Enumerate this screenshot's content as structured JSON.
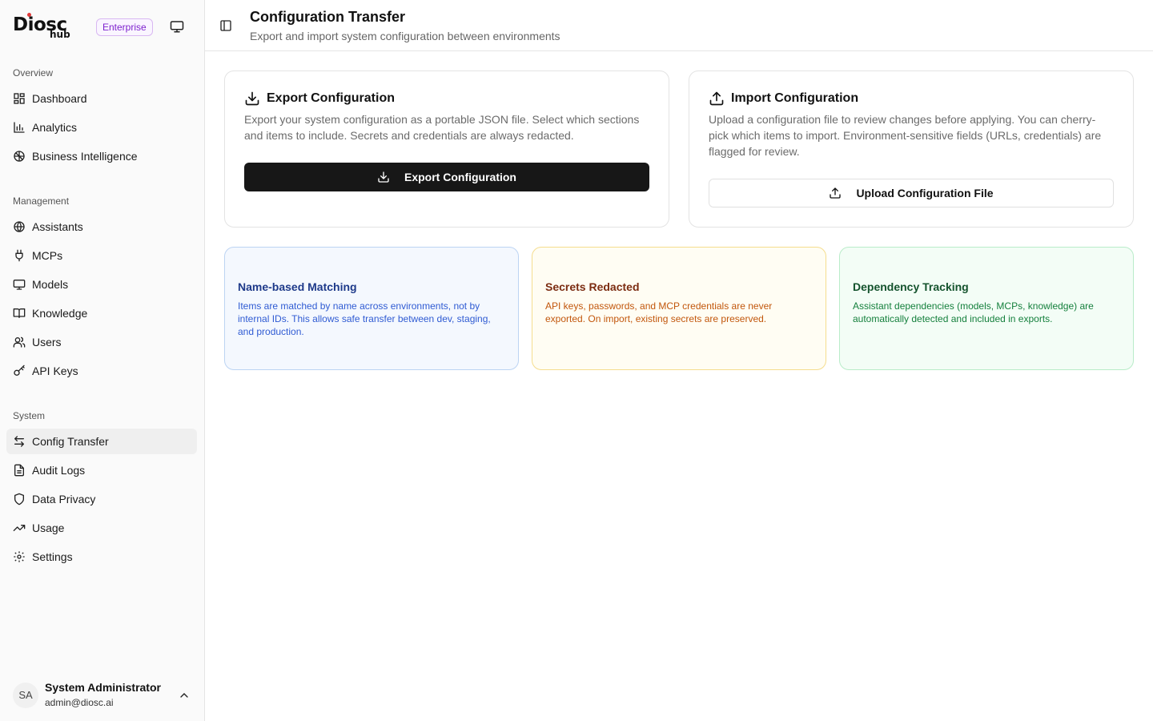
{
  "brand": {
    "logo_main": "Diosc",
    "logo_sub": "hub",
    "plan_badge": "Enterprise"
  },
  "sidebar": {
    "sections": [
      {
        "label": "Overview",
        "items": [
          {
            "label": "Dashboard",
            "icon": "grid-icon"
          },
          {
            "label": "Analytics",
            "icon": "bar-chart-icon"
          },
          {
            "label": "Business Intelligence",
            "icon": "brain-icon"
          }
        ]
      },
      {
        "label": "Management",
        "items": [
          {
            "label": "Assistants",
            "icon": "globe-icon"
          },
          {
            "label": "MCPs",
            "icon": "plug-icon"
          },
          {
            "label": "Models",
            "icon": "monitor-icon"
          },
          {
            "label": "Knowledge",
            "icon": "book-icon"
          },
          {
            "label": "Users",
            "icon": "users-icon"
          },
          {
            "label": "API Keys",
            "icon": "key-icon"
          }
        ]
      },
      {
        "label": "System",
        "items": [
          {
            "label": "Config Transfer",
            "icon": "arrows-icon",
            "active": true
          },
          {
            "label": "Audit Logs",
            "icon": "file-icon"
          },
          {
            "label": "Data Privacy",
            "icon": "shield-icon"
          },
          {
            "label": "Usage",
            "icon": "trend-icon"
          },
          {
            "label": "Settings",
            "icon": "gear-icon"
          }
        ]
      }
    ]
  },
  "user": {
    "initials": "SA",
    "name": "System Administrator",
    "email": "admin@diosc.ai"
  },
  "header": {
    "title": "Configuration Transfer",
    "subtitle": "Export and import system configuration between environments"
  },
  "export_card": {
    "title": "Export Configuration",
    "description": "Export your system configuration as a portable JSON file. Select which sections and items to include. Secrets and credentials are always redacted.",
    "button_label": "Export Configuration"
  },
  "import_card": {
    "title": "Import Configuration",
    "description": "Upload a configuration file to review changes before applying. You can cherry-pick which items to import. Environment-sensitive fields (URLs, credentials) are flagged for review.",
    "button_label": "Upload Configuration File"
  },
  "info_cards": [
    {
      "title": "Name-based Matching",
      "text": "Items are matched by name across environments, not by internal IDs. This allows safe transfer between dev, staging, and production.",
      "color": "#2f5bd3"
    },
    {
      "title": "Secrets Redacted",
      "text": "API keys, passwords, and MCP credentials are never exported. On import, existing secrets are preserved.",
      "color": "#c2570c"
    },
    {
      "title": "Dependency Tracking",
      "text": "Assistant dependencies (models, MCPs, knowledge) are automatically detected and included in exports.",
      "color": "#15803d"
    }
  ]
}
